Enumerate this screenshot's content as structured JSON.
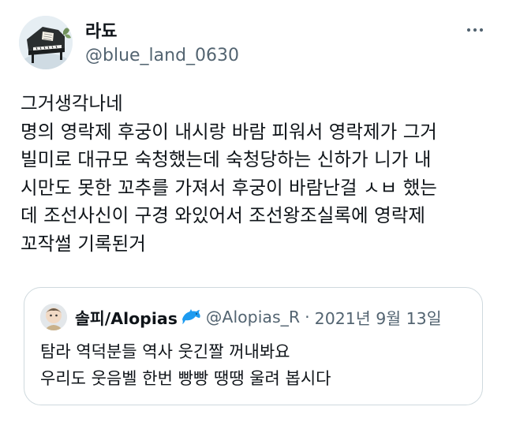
{
  "tweet": {
    "author": {
      "display_name": "라됴",
      "handle": "@blue_land_0630",
      "avatar": "profile-avatar-piano"
    },
    "more_icon": "more-horizontal-icon",
    "text_lines": [
      "그거생각나네",
      "명의 영락제 후궁이 내시랑 바람 피워서 영락제가 그거",
      "빌미로 대규모 숙청했는데 숙청당하는 신하가 니가 내",
      "시만도 못한 꼬추를 가져서 후궁이 바람난걸 ㅅㅂ 했는",
      "데 조선사신이 구경 와있어서 조선왕조실록에 영락제",
      "꼬작썰 기록된거"
    ]
  },
  "quoted_tweet": {
    "display_name": "솔피/Alopias",
    "emoji_icon": "dolphin-icon",
    "handle": "@Alopias_R",
    "separator": "·",
    "date": "2021년 9월 13일",
    "text_lines": [
      "탐라 역덕분들 역사 웃긴짤 꺼내봐요",
      "우리도 웃음벨 한번 빵빵 땡땡 울려 봅시다"
    ]
  },
  "colors": {
    "text_primary": "#0f1419",
    "text_secondary": "#536471",
    "border": "#cfd9de",
    "dolphin": "#1d9bf0"
  }
}
